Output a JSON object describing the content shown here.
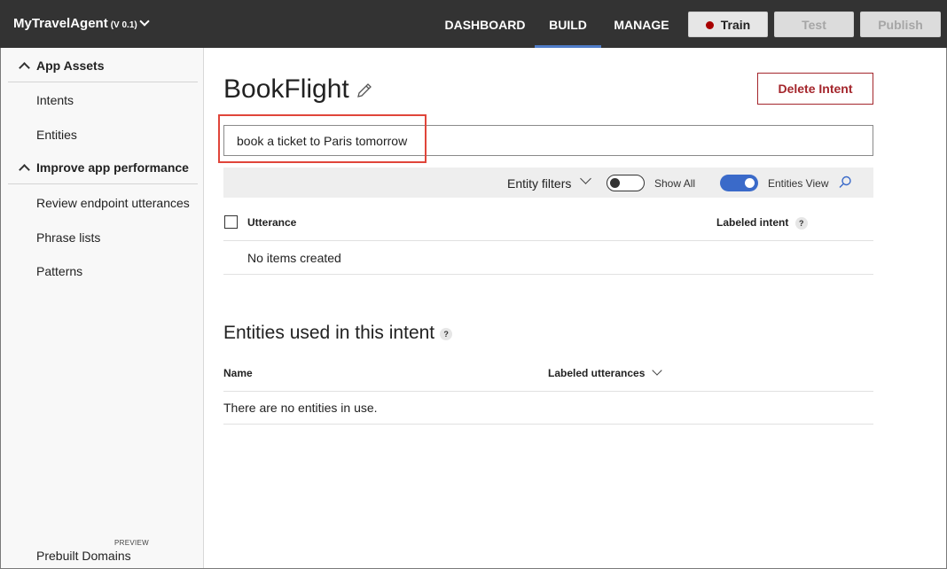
{
  "header": {
    "app_name": "MyTravelAgent",
    "version": "(V 0.1)",
    "tabs": [
      {
        "label": "DASHBOARD",
        "active": false
      },
      {
        "label": "BUILD",
        "active": true
      },
      {
        "label": "MANAGE",
        "active": false
      }
    ],
    "buttons": {
      "train": "Train",
      "test": "Test",
      "publish": "Publish"
    },
    "colors": {
      "bar": "#333333",
      "active_tab_underline": "#4f7cc8",
      "train_dot": "#a80000"
    }
  },
  "sidebar": {
    "sections": [
      {
        "label": "App Assets",
        "items": [
          "Intents",
          "Entities"
        ]
      },
      {
        "label": "Improve app performance",
        "items": [
          "Review endpoint utterances",
          "Phrase lists",
          "Patterns"
        ]
      }
    ],
    "footer_item": "Prebuilt Domains",
    "footer_badge": "PREVIEW"
  },
  "main": {
    "title": "BookFlight",
    "delete_button": "Delete Intent",
    "utterance_input_value": "book a ticket to Paris tomorrow",
    "filters": {
      "entity_filters": "Entity filters",
      "show_all": {
        "label": "Show All",
        "on": false
      },
      "entities_view": {
        "label": "Entities View",
        "on": true
      }
    },
    "utterances_table": {
      "columns": [
        "Utterance",
        "Labeled intent"
      ],
      "help_glyph": "?",
      "empty_text": "No items created"
    },
    "entities_section": {
      "title": "Entities used in this intent",
      "help_glyph": "?",
      "columns": [
        "Name",
        "Labeled utterances"
      ],
      "empty_text": "There are no entities in use."
    }
  }
}
